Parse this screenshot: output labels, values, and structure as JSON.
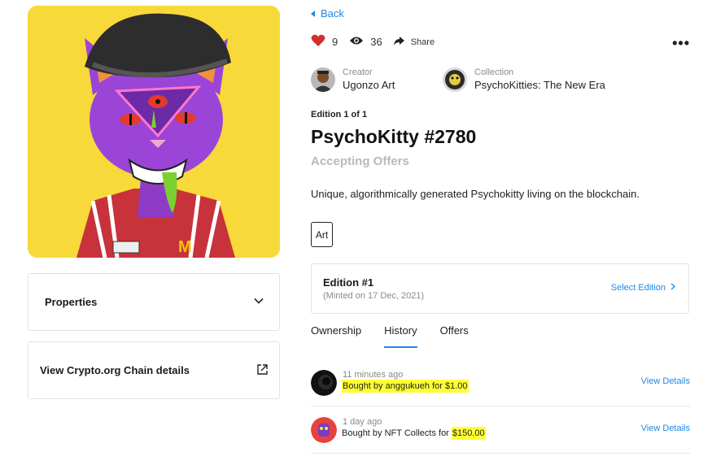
{
  "nav": {
    "back_label": "Back"
  },
  "stats": {
    "likes": "9",
    "views": "36",
    "share_label": "Share",
    "more_label": "•••"
  },
  "creator": {
    "label": "Creator",
    "name": "Ugonzo Art"
  },
  "collection": {
    "label": "Collection",
    "name": "PsychoKitties: The New Era"
  },
  "nft": {
    "edition_line": "Edition 1 of 1",
    "title": "PsychoKitty #2780",
    "status": "Accepting Offers",
    "description": "Unique, algorithmically generated Psychokitty living on the blockchain.",
    "tag": "Art"
  },
  "edition_card": {
    "title": "Edition #1",
    "minted": "(Minted on 17 Dec, 2021)",
    "select_label": "Select Edition"
  },
  "tabs": [
    {
      "label": "Ownership"
    },
    {
      "label": "History"
    },
    {
      "label": "Offers"
    }
  ],
  "history": [
    {
      "time": "11 minutes ago",
      "prefix": "Bought by anggukueh for $1.00",
      "highlight": "",
      "view_label": "View Details"
    },
    {
      "time": "1 day ago",
      "prefix": "Bought by NFT Collects for ",
      "highlight": "$150.00",
      "view_label": "View Details"
    }
  ],
  "left_panel": {
    "properties_label": "Properties",
    "chain_label": "View Crypto.org Chain details"
  },
  "colors": {
    "accent": "#1e88e5",
    "like": "#d32f2f",
    "highlight": "#ffff33",
    "artwork_bg": "#f7d93a"
  }
}
